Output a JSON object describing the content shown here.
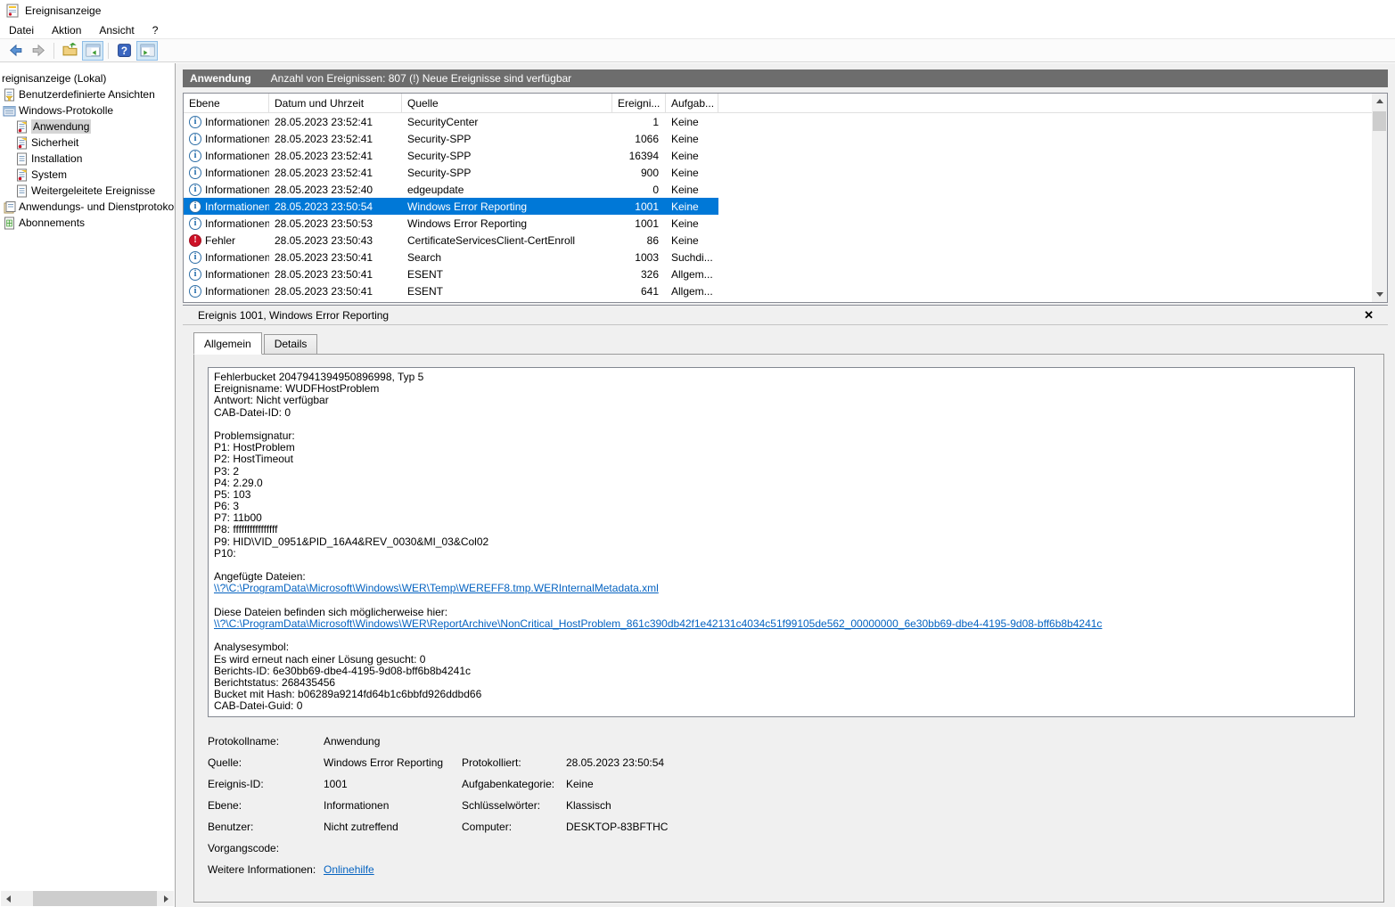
{
  "window": {
    "title": "Ereignisanzeige"
  },
  "menu": {
    "items": [
      "Datei",
      "Aktion",
      "Ansicht",
      "?"
    ]
  },
  "toolbar": {
    "buttons": [
      {
        "icon": "back-arrow",
        "toggled": false
      },
      {
        "icon": "forward-arrow",
        "toggled": false
      },
      {
        "icon": "separator"
      },
      {
        "icon": "open-folder",
        "toggled": false
      },
      {
        "icon": "console-tree-toggle",
        "toggled": true
      },
      {
        "icon": "separator"
      },
      {
        "icon": "help",
        "toggled": false
      },
      {
        "icon": "action-pane-toggle",
        "toggled": true
      }
    ]
  },
  "colors": {
    "selection_blue": "#0078d7",
    "header_gray": "#6d6d6d",
    "link_blue": "#0563c1",
    "error_red": "#ce1126",
    "info_blue": "#1a66a8"
  },
  "sidebar": {
    "items": [
      {
        "label": "reignisanzeige (Lokal)",
        "level": 0,
        "icon": "none",
        "root": true,
        "selected": false
      },
      {
        "label": "Benutzerdefinierte Ansichten",
        "level": 0,
        "icon": "custom-views",
        "selected": false
      },
      {
        "label": "Windows-Protokolle",
        "level": 0,
        "icon": "folder-console",
        "selected": false
      },
      {
        "label": "Anwendung",
        "level": 1,
        "icon": "log-event",
        "selected": true
      },
      {
        "label": "Sicherheit",
        "level": 1,
        "icon": "log-event",
        "selected": false
      },
      {
        "label": "Installation",
        "level": 1,
        "icon": "log-plain",
        "selected": false
      },
      {
        "label": "System",
        "level": 1,
        "icon": "log-event",
        "selected": false
      },
      {
        "label": "Weitergeleitete Ereignisse",
        "level": 1,
        "icon": "log-plain",
        "selected": false
      },
      {
        "label": "Anwendungs- und Dienstprotokol",
        "level": 0,
        "icon": "folder-page",
        "selected": false
      },
      {
        "label": "Abonnements",
        "level": 0,
        "icon": "subscription",
        "selected": false
      }
    ]
  },
  "list": {
    "header_log": "Anwendung",
    "header_info": "Anzahl von Ereignissen: 807 (!) Neue Ereignisse sind verfügbar",
    "columns": [
      "Ebene",
      "Datum und Uhrzeit",
      "Quelle",
      "Ereigni...",
      "Aufgab..."
    ],
    "rows": [
      {
        "level": "Informationen",
        "icon": "info",
        "datetime": "28.05.2023 23:52:41",
        "source": "SecurityCenter",
        "event_id": "1",
        "task": "Keine",
        "selected": false
      },
      {
        "level": "Informationen",
        "icon": "info",
        "datetime": "28.05.2023 23:52:41",
        "source": "Security-SPP",
        "event_id": "1066",
        "task": "Keine",
        "selected": false
      },
      {
        "level": "Informationen",
        "icon": "info",
        "datetime": "28.05.2023 23:52:41",
        "source": "Security-SPP",
        "event_id": "16394",
        "task": "Keine",
        "selected": false
      },
      {
        "level": "Informationen",
        "icon": "info",
        "datetime": "28.05.2023 23:52:41",
        "source": "Security-SPP",
        "event_id": "900",
        "task": "Keine",
        "selected": false
      },
      {
        "level": "Informationen",
        "icon": "info",
        "datetime": "28.05.2023 23:52:40",
        "source": "edgeupdate",
        "event_id": "0",
        "task": "Keine",
        "selected": false
      },
      {
        "level": "Informationen",
        "icon": "info",
        "datetime": "28.05.2023 23:50:54",
        "source": "Windows Error Reporting",
        "event_id": "1001",
        "task": "Keine",
        "selected": true
      },
      {
        "level": "Informationen",
        "icon": "info",
        "datetime": "28.05.2023 23:50:53",
        "source": "Windows Error Reporting",
        "event_id": "1001",
        "task": "Keine",
        "selected": false
      },
      {
        "level": "Fehler",
        "icon": "error",
        "datetime": "28.05.2023 23:50:43",
        "source": "CertificateServicesClient-CertEnroll",
        "event_id": "86",
        "task": "Keine",
        "selected": false
      },
      {
        "level": "Informationen",
        "icon": "info",
        "datetime": "28.05.2023 23:50:41",
        "source": "Search",
        "event_id": "1003",
        "task": "Suchdi...",
        "selected": false
      },
      {
        "level": "Informationen",
        "icon": "info",
        "datetime": "28.05.2023 23:50:41",
        "source": "ESENT",
        "event_id": "326",
        "task": "Allgem...",
        "selected": false
      },
      {
        "level": "Informationen",
        "icon": "info",
        "datetime": "28.05.2023 23:50:41",
        "source": "ESENT",
        "event_id": "641",
        "task": "Allgem...",
        "selected": false
      }
    ]
  },
  "detail": {
    "title": "Ereignis 1001, Windows Error Reporting",
    "close_label": "✕",
    "tabs": [
      {
        "label": "Allgemein",
        "active": true
      },
      {
        "label": "Details",
        "active": false
      }
    ],
    "body_lines": [
      "Fehlerbucket 2047941394950896998, Typ 5",
      "Ereignisname: WUDFHostProblem",
      "Antwort: Nicht verfügbar",
      "CAB-Datei-ID: 0",
      "",
      "Problemsignatur:",
      "P1: HostProblem",
      "P2: HostTimeout",
      "P3: 2",
      "P4: 2.29.0",
      "P5: 103",
      "P6: 3",
      "P7: 11b00",
      "P8: ffffffffffffffff",
      "P9: HID\\VID_0951&PID_16A4&REV_0030&MI_03&Col02",
      "P10:",
      "",
      "Angefügte Dateien:",
      {
        "text": "\\\\?\\C:\\ProgramData\\Microsoft\\Windows\\WER\\Temp\\WEREFF8.tmp.WERInternalMetadata.xml",
        "link": true
      },
      "",
      "Diese Dateien befinden sich möglicherweise hier:",
      {
        "text": "\\\\?\\C:\\ProgramData\\Microsoft\\Windows\\WER\\ReportArchive\\NonCritical_HostProblem_861c390db42f1e42131c4034c51f99105de562_00000000_6e30bb69-dbe4-4195-9d08-bff6b8b4241c",
        "link": true
      },
      "",
      "Analysesymbol:",
      "Es wird erneut nach einer Lösung gesucht: 0",
      "Berichts-ID: 6e30bb69-dbe4-4195-9d08-bff6b8b4241c",
      "Berichtstatus: 268435456",
      "Bucket mit Hash: b06289a9214fd64b1c6bbfd926ddbd66",
      "CAB-Datei-Guid: 0"
    ],
    "fields": [
      {
        "l1": "Protokollname:",
        "v1": "Anwendung",
        "l2": "",
        "v2": ""
      },
      {
        "l1": "Quelle:",
        "v1": "Windows Error Reporting",
        "l2": "Protokolliert:",
        "v2": "28.05.2023 23:50:54"
      },
      {
        "l1": "Ereignis-ID:",
        "v1": "1001",
        "l2": "Aufgabenkategorie:",
        "v2": "Keine"
      },
      {
        "l1": "Ebene:",
        "v1": "Informationen",
        "l2": "Schlüsselwörter:",
        "v2": "Klassisch"
      },
      {
        "l1": "Benutzer:",
        "v1": "Nicht zutreffend",
        "l2": "Computer:",
        "v2": "DESKTOP-83BFTHC"
      },
      {
        "l1": "Vorgangscode:",
        "v1": "",
        "l2": "",
        "v2": ""
      },
      {
        "l1": "Weitere Informationen:",
        "v1": "Onlinehilfe",
        "v1_link": true,
        "l2": "",
        "v2": ""
      }
    ]
  }
}
